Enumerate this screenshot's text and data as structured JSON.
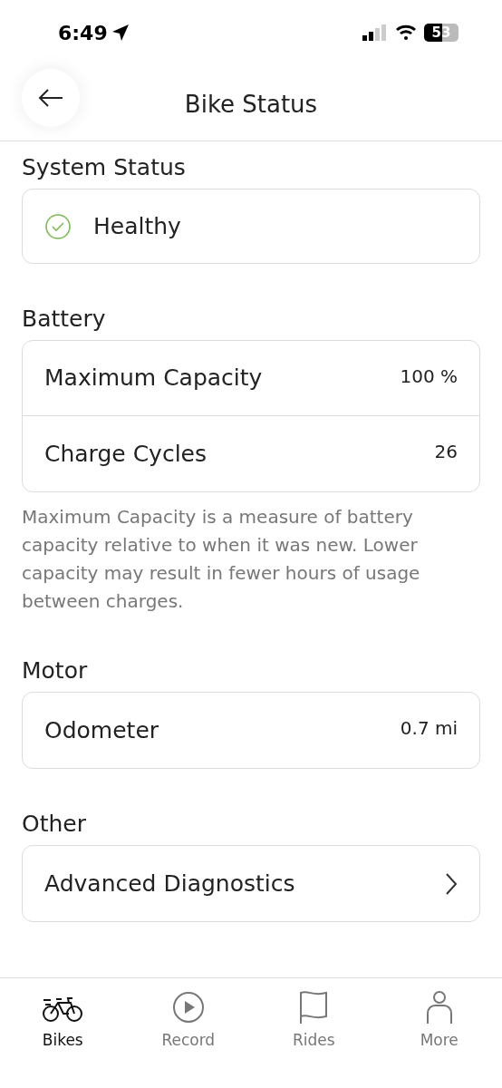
{
  "status_bar": {
    "time": "6:49",
    "battery": "53"
  },
  "header": {
    "title": "Bike Status"
  },
  "sections": [
    {
      "title": "System Status",
      "status": {
        "label": "Healthy",
        "healthy": true
      }
    },
    {
      "title": "Battery",
      "rows": [
        {
          "kind": "value",
          "label": "Maximum Capacity",
          "value": "100 %"
        },
        {
          "kind": "value",
          "label": "Charge Cycles",
          "value": "26"
        }
      ],
      "note": "Maximum Capacity is a measure of battery capacity relative to when it was new. Lower capacity may result in fewer hours of usage between charges."
    },
    {
      "title": "Motor",
      "rows": [
        {
          "kind": "value",
          "label": "Odometer",
          "value": "0.7 mi"
        }
      ]
    },
    {
      "title": "Other",
      "rows": [
        {
          "kind": "link",
          "label": "Advanced Diagnostics"
        }
      ]
    }
  ],
  "tabs": [
    {
      "label": "Bikes",
      "selected": true
    },
    {
      "label": "Record",
      "selected": false
    },
    {
      "label": "Rides",
      "selected": false
    },
    {
      "label": "More",
      "selected": false
    }
  ]
}
